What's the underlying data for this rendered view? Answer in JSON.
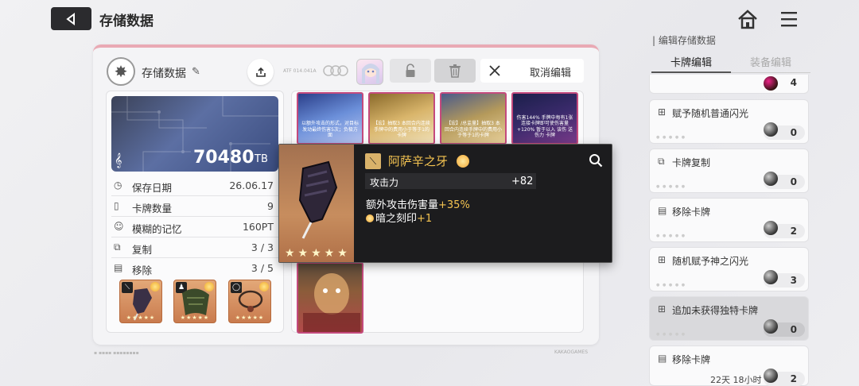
{
  "header": {
    "title": "存储数据"
  },
  "panel": {
    "storage_label": "存储数据",
    "tiny_label": "ATF 014.041A",
    "cancel_label": "取消编辑"
  },
  "info": {
    "tb_value": "70480",
    "tb_unit": "TB",
    "stats": [
      {
        "label": "保存日期",
        "value": "26.06.17",
        "icon": "calendar-icon"
      },
      {
        "label": "卡牌数量",
        "value": "9",
        "icon": "card-count-icon"
      },
      {
        "label": "模糊的记忆",
        "value": "160PT",
        "icon": "memory-icon"
      },
      {
        "label": "复制",
        "value": "3 / 3",
        "icon": "copy-icon"
      },
      {
        "label": "移除",
        "value": "3 / 5",
        "icon": "remove-icon"
      }
    ],
    "equip_stars": "★★★★★"
  },
  "cards": [
    {
      "text": "以额外攻击的形式，对目标发动最终伤害5次；负极方面"
    },
    {
      "text": "【宏】抽取3 本回合内连续手牌中的费用小于等于1的卡牌"
    },
    {
      "text": "【宏】/总监量】抽取3 本回合内连续手牌中的费用小于等于1的卡牌"
    },
    {
      "text": "伤害144% 手牌中每有1张连接卡牌即可使伤害量+120% 暂于以入 该伤 送伤力 卡牌"
    }
  ],
  "tooltip": {
    "name": "阿萨辛之牙",
    "stat_label": "攻击力",
    "stat_value": "+82",
    "line1_prefix": "额外攻击伤害量",
    "line1_value": "+35%",
    "line2_prefix": "暗之刻印",
    "line2_value": "+1",
    "stars": "★★★★★"
  },
  "right_panel": {
    "title": "编辑存储数据",
    "tab_active": "卡牌编辑",
    "tab_inactive": "装备编辑",
    "top_count": "4",
    "items": [
      {
        "label": "赋予随机普通闪光",
        "count": "0",
        "time": "",
        "icon": "card-add-icon"
      },
      {
        "label": "卡牌复制",
        "count": "0",
        "time": "",
        "icon": "copy-icon"
      },
      {
        "label": "移除卡牌",
        "count": "2",
        "time": "",
        "icon": "remove-icon"
      },
      {
        "label": "随机赋予神之闪光",
        "count": "3",
        "time": "",
        "icon": "card-add-icon"
      },
      {
        "label": "追加未获得独特卡牌",
        "count": "0",
        "time": "",
        "icon": "card-add-icon"
      },
      {
        "label": "移除卡牌",
        "count": "2",
        "time": "22天 18小时",
        "icon": "remove-icon"
      }
    ]
  },
  "footer": {
    "brand": "KAKAOGAMES"
  }
}
